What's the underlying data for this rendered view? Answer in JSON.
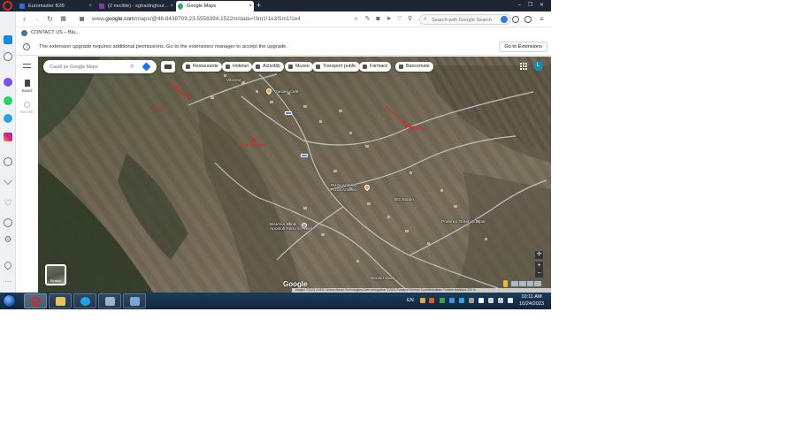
{
  "browser": {
    "tabs": [
      {
        "title": "Euromaster B2B",
        "close": "×",
        "color": "#2f6fd6"
      },
      {
        "title": "(2 necitite) - sgtradingtour...",
        "close": "×",
        "color": "#7b3fa0"
      },
      {
        "title": "Google Maps",
        "close": "×",
        "color": "#34a853"
      }
    ],
    "new_tab": "+",
    "window_controls": [
      "⎯",
      "❐",
      "✕"
    ],
    "url_prefix": "www.",
    "url_domain": "google.com",
    "url_path": "/maps/@46.8438709,23.5558394,1522m/data=!3m1!1e3!5m1!1e4",
    "search_placeholder": "Search with Google Search"
  },
  "bookmarks": [
    {
      "label": "CONTACT US – Blu..."
    }
  ],
  "notice": {
    "text": "The extension upgrade requires additional permissions. Go to the extensions manager to accept the upgrade.",
    "button": "Go to Extensions",
    "icon": "i"
  },
  "maps": {
    "panel": {
      "saved": "Saved",
      "recents": "Recents"
    },
    "search_placeholder": "Caută pe Google Maps",
    "chips": [
      "Restaurante",
      "Hoteluri",
      "Activități",
      "Muzee",
      "Transport public",
      "Farmacii",
      "Bancomate"
    ],
    "account_initial": "L",
    "layers_label": "Straturi",
    "zoom_in": "+",
    "zoom_out": "−",
    "logo": "Google",
    "attribution": "Imagini ©2023 CNES / Airbus,Maxar Technologies,Date cartografice ©2023    România    Termeni    Confidențialitate    Trimiteți feedback    200 m",
    "places": [
      {
        "name": "Garden Café"
      },
      {
        "name": "Pizza Antonio\nPizza Antonio"
      },
      {
        "name": "BG Studio"
      },
      {
        "name": "Biserica Sfinții\nApostoli Petru și Pavel"
      },
      {
        "name": "Podoreu Green și Sipar"
      },
      {
        "name": "Sentier Dacii"
      },
      {
        "name": "Vila Dor"
      }
    ],
    "red_notes": [
      "Drumeț",
      "Chirlitelor",
      "Pe drum 4x4"
    ]
  },
  "taskbar": {
    "lang": "EN",
    "time": "10:11 AM",
    "date": "10/24/2023"
  }
}
